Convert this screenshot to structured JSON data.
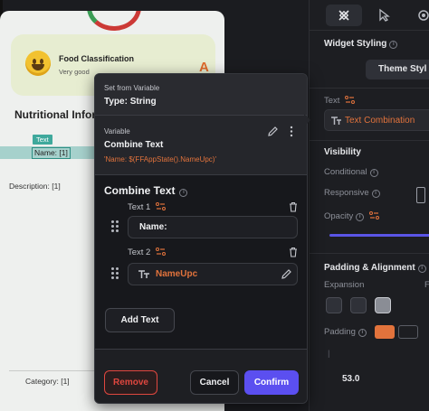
{
  "canvas": {
    "food_card": {
      "title": "Food Classification",
      "subtitle": "Very good",
      "grade": "A"
    },
    "section_title": "Nutritional Infor",
    "selected_tag": "Text",
    "name_text": "Name: [1]",
    "description_text": "Description: [1]",
    "category_text": "Category: [1]"
  },
  "right_panel": {
    "widget_styling": "Widget Styling",
    "theme_button": "Theme Styl",
    "text_label": "Text",
    "text_combination": "Text Combination",
    "visibility": "Visibility",
    "conditional": "Conditional",
    "responsive": "Responsive",
    "opacity": "Opacity",
    "padding_alignment": "Padding & Alignment",
    "expansion": "Expansion",
    "expansion_cut": "F",
    "padding": "Padding",
    "padding_value": "53.0"
  },
  "modal": {
    "set_from_variable": "Set from Variable",
    "type_line": "Type: String",
    "variable_label": "Variable",
    "variable_name": "Combine Text",
    "variable_expr": "'Name: $(FFAppState().NameUpc)'",
    "section_title": "Combine Text",
    "text1_label": "Text 1",
    "text1_value": "Name:",
    "text2_label": "Text 2",
    "text2_value": "NameUpc",
    "add_text": "Add Text",
    "remove": "Remove",
    "cancel": "Cancel",
    "confirm": "Confirm"
  },
  "colors": {
    "accent": "#5b4ff0",
    "orange": "#e2733c",
    "remove_red": "#e0473f",
    "selection_teal": "#3fa99c"
  },
  "icons": [
    "paint-tool-icon",
    "cursor-tool-icon",
    "gear-icon",
    "info-icon",
    "variable-icon",
    "edit-icon",
    "more-vert-icon",
    "delete-icon",
    "drag-handle-icon",
    "text-type-icon",
    "phone-icon"
  ]
}
